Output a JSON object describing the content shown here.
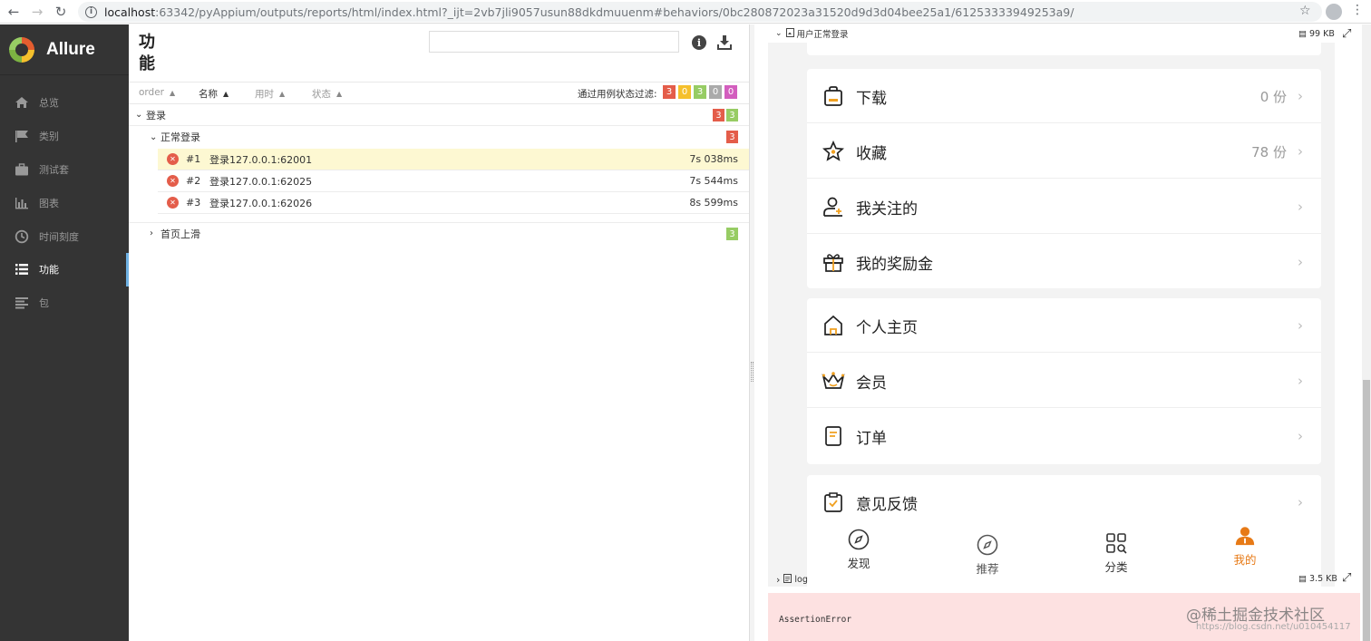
{
  "browser": {
    "url_host": "localhost",
    "url_path": ":63342/pyAppium/outputs/reports/html/index.html?_ijt=2vb7jli9057usun88dkdmuuenm#behaviors/0bc280872023a31520d9d3d04bee25a1/61253333949253a9/"
  },
  "sidebar": {
    "logo": "Allure",
    "items": [
      {
        "label": "总览",
        "icon": "home-icon"
      },
      {
        "label": "类别",
        "icon": "flag-icon"
      },
      {
        "label": "测试套",
        "icon": "briefcase-icon"
      },
      {
        "label": "图表",
        "icon": "bar-chart-icon"
      },
      {
        "label": "时间刻度",
        "icon": "clock-icon"
      },
      {
        "label": "功能",
        "icon": "list-icon",
        "active": true
      },
      {
        "label": "包",
        "icon": "align-left-icon"
      }
    ]
  },
  "main": {
    "title": "功能",
    "search_placeholder": "",
    "sort": {
      "order": "order",
      "name": "名称",
      "duration": "用时",
      "status": "状态"
    },
    "filter_label": "通过用例状态过滤:",
    "filter_counts": [
      {
        "value": "3",
        "color": "#e45d4a"
      },
      {
        "value": "0",
        "color": "#f5c02c"
      },
      {
        "value": "3",
        "color": "#97cc64"
      },
      {
        "value": "0",
        "color": "#aaaaaa"
      },
      {
        "value": "0",
        "color": "#d35ebe"
      }
    ],
    "tree": {
      "group1": {
        "label": "登录",
        "failed": "3",
        "passed": "3"
      },
      "subgroup": {
        "label": "正常登录",
        "failed": "3"
      },
      "cases": [
        {
          "num": "#1",
          "name": "登录127.0.0.1:62001",
          "time": "7s 038ms"
        },
        {
          "num": "#2",
          "name": "登录127.0.0.1:62025",
          "time": "7s 544ms"
        },
        {
          "num": "#3",
          "name": "登录127.0.0.1:62026",
          "time": "8s 599ms"
        }
      ],
      "group2": {
        "label": "首页上滑",
        "passed": "3"
      }
    }
  },
  "attachment": {
    "title": "用户正常登录",
    "size": "99 KB",
    "menu": [
      {
        "label": "下载",
        "value": "0 份",
        "icon": "bag-icon"
      },
      {
        "label": "收藏",
        "value": "78 份",
        "icon": "star-icon"
      },
      {
        "label": "我关注的",
        "value": "",
        "icon": "user-follow-icon"
      },
      {
        "label": "我的奖励金",
        "value": "",
        "icon": "gift-icon"
      },
      {
        "label": "个人主页",
        "value": "",
        "icon": "house-icon"
      },
      {
        "label": "会员",
        "value": "",
        "icon": "crown-icon"
      },
      {
        "label": "订单",
        "value": "",
        "icon": "order-icon"
      },
      {
        "label": "意见反馈",
        "value": "",
        "icon": "feedback-icon"
      }
    ],
    "tabs": [
      {
        "label": "发现",
        "icon": "compass-icon"
      },
      {
        "label": "推荐",
        "icon": "compass-icon"
      },
      {
        "label": "分类",
        "icon": "category-icon"
      },
      {
        "label": "我的",
        "icon": "user-icon",
        "active": true
      }
    ]
  },
  "log": {
    "title": "log",
    "size": "3.5 KB",
    "error": "AssertionError"
  },
  "watermark": {
    "main": "@稀土掘金技术社区",
    "sub": "https://blog.csdn.net/u010454117"
  }
}
